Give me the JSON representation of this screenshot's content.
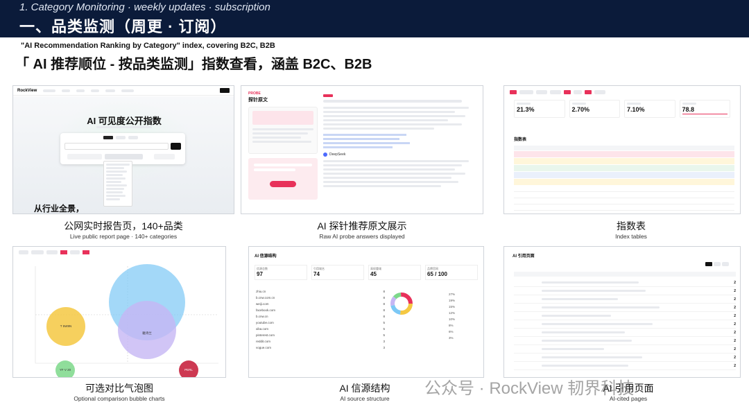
{
  "header": {
    "subtitle": "1. Category Monitoring · weekly updates · subscription",
    "title": "一、品类监测（周更 · 订阅）"
  },
  "context_label": "\"AI Recommendation Ranking by Category\" index, covering B2C, B2B",
  "headline": "「 AI 推荐顺位 - 按品类监测」指数查看，涵盖 B2C、B2B",
  "panels": [
    {
      "caption": "公网实时报告页，140+品类",
      "caption_en": "Live public report page · 140+ categories"
    },
    {
      "caption": "AI 探针推荐原文展示",
      "caption_en": "Raw AI probe answers displayed"
    },
    {
      "caption": "指数表",
      "caption_en": "Index tables"
    },
    {
      "caption": "可选对比气泡图",
      "caption_en": "Optional comparison bubble charts"
    },
    {
      "caption": "AI 信源结构",
      "caption_en": "AI source structure"
    },
    {
      "caption": "AI 引用页面",
      "caption_en": "AI-cited pages"
    }
  ],
  "screen1": {
    "logo": "RockView",
    "hero": "AI 可见度公开指数",
    "bottom": "从行业全景，"
  },
  "screen2": {
    "title": "探针原文",
    "ds_label": "DeepSeek"
  },
  "screen3": {
    "kpis": [
      "21.3%",
      "2.70%",
      "7.10%",
      "78.8"
    ],
    "table_title": "指数表"
  },
  "screen4": {
    "bubbles": [
      "T 5W9N",
      "雅诗兰",
      "YF V 20",
      "PERL"
    ]
  },
  "screen5": {
    "title": "AI 信源结构",
    "kpis": [
      {
        "label": "信源总数",
        "value": "97"
      },
      {
        "label": "引用域名",
        "value": "74"
      },
      {
        "label": "高权重域",
        "value": "45"
      },
      {
        "label": "品牌官网",
        "value": "65 / 100"
      }
    ],
    "domains": [
      "zhiu.cn",
      "b.cnw.com.cn",
      "weiji.com",
      "facebook.com",
      "b.cnw.cn",
      "youtube.com",
      "xiba.com",
      "pinterest.com",
      "reddit.com",
      "vogue.com"
    ],
    "shares": [
      "27%",
      "19%",
      "15%",
      "12%",
      "10%",
      "8%",
      "6%",
      "3%"
    ]
  },
  "screen6": {
    "title": "AI 引用页面",
    "counts": [
      "2",
      "2",
      "2",
      "2",
      "2",
      "2",
      "2",
      "2",
      "2",
      "2",
      "2"
    ]
  },
  "watermark": "公众号 · RockView 韧界科技",
  "colors": {
    "header_bg": "#0b1b3a",
    "accent_pink": "#e8315a"
  }
}
